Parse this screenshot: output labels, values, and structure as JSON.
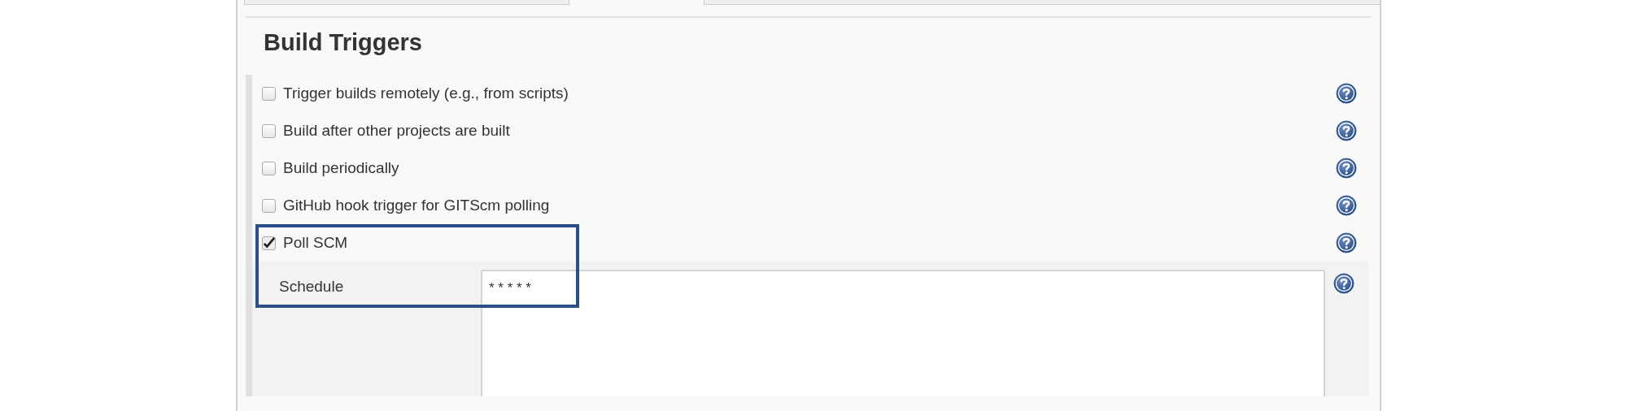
{
  "section": {
    "title": "Build Triggers"
  },
  "triggers": [
    {
      "label": "Trigger builds remotely (e.g., from scripts)",
      "checked": false
    },
    {
      "label": "Build after other projects are built",
      "checked": false
    },
    {
      "label": "Build periodically",
      "checked": false
    },
    {
      "label": "GitHub hook trigger for GITScm polling",
      "checked": false
    },
    {
      "label": "Poll SCM",
      "checked": true
    }
  ],
  "schedule": {
    "label": "Schedule",
    "value": "* * * * *"
  }
}
